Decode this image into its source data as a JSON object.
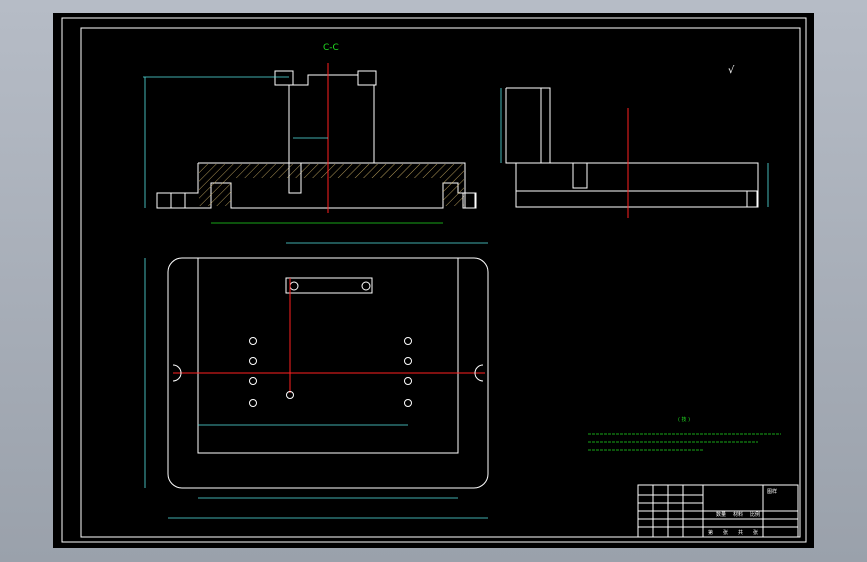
{
  "section_label": "C-C",
  "roughness_mark": "√",
  "notes_title": "( 技 )",
  "title_block": {
    "cells": [
      "图样",
      "数量",
      "材料",
      "比例",
      "第",
      "张",
      "共",
      "张"
    ]
  },
  "colors": {
    "background": "#000000",
    "frame": "#ffffff",
    "dimension": "#55e5e5",
    "centerline": "#ff2020",
    "notes": "#22dd22"
  }
}
